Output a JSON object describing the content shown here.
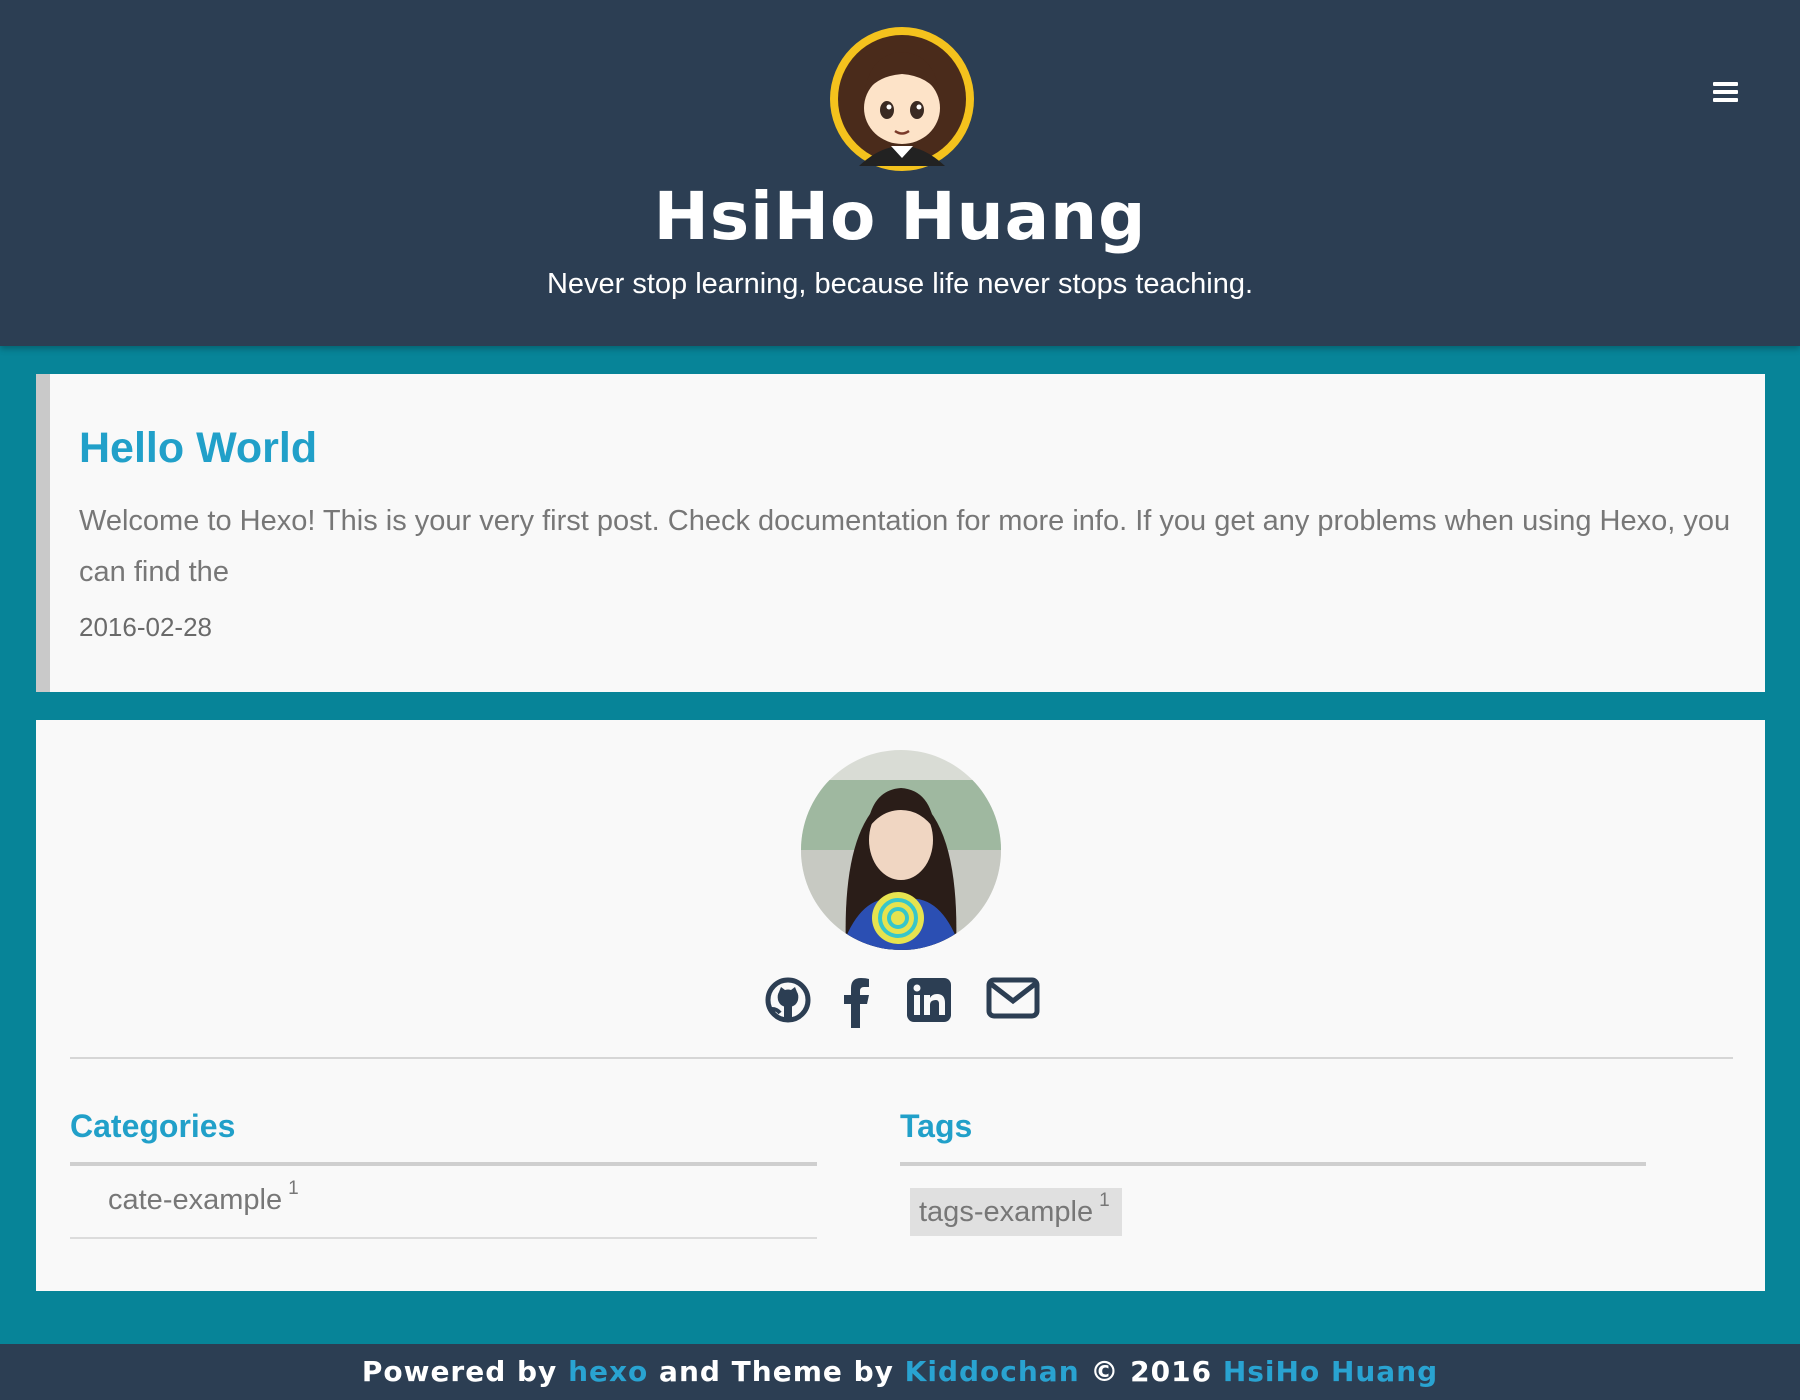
{
  "header": {
    "title": "HsiHo Huang",
    "subtitle": "Never stop learning, because life never stops teaching.",
    "logo_icon": "cartoon-girl-avatar",
    "menu_icon": "hamburger-menu-icon"
  },
  "post": {
    "title": "Hello World",
    "excerpt": "Welcome to Hexo! This is your very first post. Check documentation for more info. If you get any problems when using Hexo, you can find the",
    "date": "2016-02-28"
  },
  "profile": {
    "avatar": "profile-photo",
    "social": [
      {
        "name": "github-icon"
      },
      {
        "name": "facebook-icon"
      },
      {
        "name": "linkedin-icon"
      },
      {
        "name": "envelope-icon"
      }
    ]
  },
  "categories": {
    "title": "Categories",
    "items": [
      {
        "label": "cate-example",
        "count": "1"
      }
    ]
  },
  "tags": {
    "title": "Tags",
    "items": [
      {
        "label": "tags-example",
        "count": "1"
      }
    ]
  },
  "footer": {
    "powered_by": "Powered by",
    "hexo_link": "hexo",
    "theme_by": "and Theme by",
    "theme_link": "Kiddochan",
    "copyright": "© 2016",
    "author_link": "HsiHo Huang"
  },
  "colors": {
    "header_bg": "#2c3e53",
    "page_bg": "#078498",
    "accent": "#21a0c9",
    "card_bg": "#f9f9f9"
  }
}
